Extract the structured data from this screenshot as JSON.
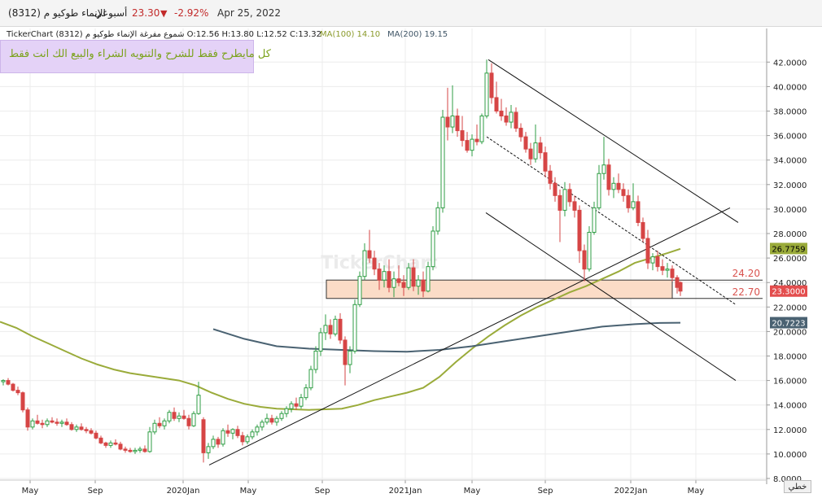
{
  "header": {
    "date": "Apr 25, 2022",
    "change": "-2.92%",
    "price": "23.30",
    "period": "أسبوعي",
    "name": "الإنماء طوكيو م (8312)"
  },
  "info": {
    "line": "TickerChart شموع مفرغة  الإنماء طوكيو م (8312) O:12.56 H:13.80 L:12.52 C:13.32",
    "ma100": "MA(100) 14.10",
    "ma200": "MA(200) 19.15"
  },
  "note": "كل مايطرح فقط للشرح  والتنويه الشراء والبيع الك انت فقط",
  "watermark": "TickerChart",
  "footer_button": "خطي",
  "colors": {
    "up": "#2f9e44",
    "down": "#d64545",
    "ma100": "#9aab3a",
    "ma200": "#4a6272",
    "zone_fill": "#fbdcc7",
    "last_price_tag": "#e34d4d"
  },
  "chart_data": {
    "type": "candlestick",
    "ylim": [
      8,
      43
    ],
    "y_ticks": [
      "8.0000",
      "10.0000",
      "12.0000",
      "14.0000",
      "16.0000",
      "18.0000",
      "20.0000",
      "22.0000",
      "24.0000",
      "26.0000",
      "28.0000",
      "30.0000",
      "32.0000",
      "34.0000",
      "36.0000",
      "38.0000",
      "40.0000",
      "42.0000"
    ],
    "x_ticks": [
      "May",
      "Sep",
      "2020Jan",
      "May",
      "Sep",
      "2021Jan",
      "May",
      "Sep",
      "2022Jan",
      "May"
    ],
    "last_price": "23.3000",
    "ma100_value": "26.7759",
    "ma200_value": "20.7223",
    "support_zone": {
      "high": 24.2,
      "low": 22.7,
      "high_label": "24.20",
      "low_label": "22.70"
    },
    "series": [
      {
        "name": "MA(100)",
        "points": [
          [
            0,
            20.8
          ],
          [
            20,
            20.3
          ],
          [
            40,
            19.6
          ],
          [
            60,
            19.0
          ],
          [
            80,
            18.4
          ],
          [
            100,
            17.8
          ],
          [
            120,
            17.3
          ],
          [
            140,
            16.9
          ],
          [
            160,
            16.6
          ],
          [
            180,
            16.4
          ],
          [
            200,
            16.2
          ],
          [
            220,
            16.0
          ],
          [
            240,
            15.6
          ],
          [
            260,
            15.0
          ],
          [
            280,
            14.5
          ],
          [
            300,
            14.1
          ],
          [
            320,
            13.85
          ],
          [
            340,
            13.7
          ],
          [
            360,
            13.65
          ],
          [
            380,
            13.6
          ],
          [
            400,
            13.65
          ],
          [
            420,
            13.7
          ],
          [
            440,
            14.0
          ],
          [
            460,
            14.4
          ],
          [
            480,
            14.7
          ],
          [
            500,
            15.0
          ],
          [
            520,
            15.4
          ],
          [
            540,
            16.3
          ],
          [
            560,
            17.5
          ],
          [
            580,
            18.6
          ],
          [
            600,
            19.6
          ],
          [
            620,
            20.5
          ],
          [
            640,
            21.3
          ],
          [
            660,
            22.0
          ],
          [
            680,
            22.6
          ],
          [
            700,
            23.2
          ],
          [
            720,
            23.7
          ],
          [
            740,
            24.3
          ],
          [
            760,
            24.9
          ],
          [
            780,
            25.6
          ],
          [
            800,
            26.0
          ],
          [
            820,
            26.4
          ],
          [
            836,
            26.75
          ]
        ]
      },
      {
        "name": "MA(200)",
        "points": [
          [
            262,
            20.2
          ],
          [
            300,
            19.4
          ],
          [
            340,
            18.8
          ],
          [
            380,
            18.6
          ],
          [
            420,
            18.5
          ],
          [
            460,
            18.4
          ],
          [
            500,
            18.35
          ],
          [
            540,
            18.5
          ],
          [
            580,
            18.8
          ],
          [
            620,
            19.2
          ],
          [
            660,
            19.6
          ],
          [
            700,
            20.0
          ],
          [
            740,
            20.4
          ],
          [
            780,
            20.6
          ],
          [
            810,
            20.7
          ],
          [
            836,
            20.72
          ]
        ]
      }
    ],
    "candles": [
      [
        4,
        15.9,
        16.1,
        15.6,
        16.0
      ],
      [
        10,
        16.0,
        16.2,
        15.6,
        15.7
      ],
      [
        16,
        15.7,
        15.8,
        15.1,
        15.2
      ],
      [
        22,
        15.2,
        15.5,
        14.8,
        15.0
      ],
      [
        28,
        15.0,
        15.1,
        13.4,
        13.6
      ],
      [
        34,
        13.6,
        13.8,
        11.9,
        12.2
      ],
      [
        40,
        12.2,
        12.9,
        12.0,
        12.7
      ],
      [
        46,
        12.7,
        13.2,
        12.4,
        12.5
      ],
      [
        52,
        12.5,
        12.8,
        12.1,
        12.4
      ],
      [
        58,
        12.4,
        12.9,
        12.2,
        12.7
      ],
      [
        64,
        12.7,
        13.0,
        12.5,
        12.6
      ],
      [
        70,
        12.6,
        12.9,
        12.3,
        12.5
      ],
      [
        76,
        12.5,
        12.8,
        12.2,
        12.6
      ],
      [
        82,
        12.6,
        12.9,
        12.3,
        12.4
      ],
      [
        88,
        12.4,
        12.6,
        11.9,
        12.0
      ],
      [
        94,
        12.0,
        12.4,
        11.8,
        12.2
      ],
      [
        100,
        12.2,
        12.5,
        11.9,
        12.0
      ],
      [
        106,
        12.0,
        12.2,
        11.7,
        11.9
      ],
      [
        112,
        11.9,
        12.1,
        11.6,
        11.7
      ],
      [
        118,
        11.7,
        11.9,
        11.2,
        11.3
      ],
      [
        124,
        11.3,
        11.5,
        10.8,
        10.9
      ],
      [
        130,
        10.9,
        11.0,
        10.5,
        10.7
      ],
      [
        136,
        10.7,
        11.1,
        10.5,
        10.9
      ],
      [
        142,
        10.9,
        11.2,
        10.7,
        10.8
      ],
      [
        148,
        10.8,
        11.0,
        10.3,
        10.4
      ],
      [
        154,
        10.4,
        10.6,
        10.1,
        10.3
      ],
      [
        160,
        10.3,
        10.5,
        10.1,
        10.2
      ],
      [
        166,
        10.2,
        10.5,
        10.0,
        10.3
      ],
      [
        172,
        10.3,
        10.6,
        10.1,
        10.4
      ],
      [
        178,
        10.4,
        10.7,
        10.1,
        10.2
      ],
      [
        184,
        10.2,
        12.2,
        10.1,
        11.8
      ],
      [
        190,
        11.8,
        12.8,
        11.6,
        12.5
      ],
      [
        196,
        12.5,
        13.0,
        12.1,
        12.3
      ],
      [
        202,
        12.3,
        12.9,
        12.0,
        12.7
      ],
      [
        208,
        12.7,
        13.6,
        12.5,
        13.4
      ],
      [
        214,
        13.4,
        13.8,
        12.7,
        12.9
      ],
      [
        220,
        12.9,
        13.4,
        12.6,
        13.1
      ],
      [
        226,
        13.1,
        13.6,
        12.8,
        12.9
      ],
      [
        232,
        12.9,
        13.2,
        12.0,
        12.3
      ],
      [
        238,
        12.3,
        13.5,
        12.2,
        13.3
      ],
      [
        244,
        13.3,
        15.9,
        13.2,
        14.8
      ],
      [
        250,
        12.8,
        13.0,
        9.3,
        10.1
      ],
      [
        256,
        10.1,
        10.9,
        9.6,
        10.6
      ],
      [
        262,
        10.6,
        11.5,
        10.4,
        11.2
      ],
      [
        268,
        11.2,
        11.4,
        10.5,
        10.8
      ],
      [
        274,
        10.8,
        12.1,
        10.6,
        11.9
      ],
      [
        280,
        11.9,
        12.4,
        11.4,
        11.7
      ],
      [
        286,
        11.7,
        12.1,
        11.2,
        12.0
      ],
      [
        292,
        12.0,
        12.3,
        11.3,
        11.5
      ],
      [
        298,
        11.5,
        11.8,
        10.7,
        11.0
      ],
      [
        304,
        11.0,
        11.6,
        10.8,
        11.4
      ],
      [
        310,
        11.4,
        12.0,
        11.2,
        11.8
      ],
      [
        316,
        11.8,
        12.4,
        11.5,
        12.2
      ],
      [
        322,
        12.2,
        12.8,
        11.9,
        12.6
      ],
      [
        328,
        12.6,
        13.3,
        12.4,
        12.9
      ],
      [
        334,
        12.9,
        13.2,
        12.4,
        12.6
      ],
      [
        340,
        12.6,
        13.1,
        12.3,
        12.9
      ],
      [
        346,
        12.9,
        13.5,
        12.7,
        13.3
      ],
      [
        352,
        13.3,
        13.9,
        13.0,
        13.7
      ],
      [
        358,
        13.7,
        14.3,
        13.4,
        14.1
      ],
      [
        364,
        14.1,
        14.6,
        13.6,
        13.9
      ],
      [
        370,
        13.9,
        14.9,
        13.7,
        14.6
      ],
      [
        376,
        14.6,
        15.7,
        14.4,
        15.4
      ],
      [
        382,
        15.4,
        17.2,
        15.2,
        16.9
      ],
      [
        388,
        16.9,
        18.8,
        16.6,
        18.4
      ],
      [
        394,
        18.4,
        20.3,
        18.0,
        19.9
      ],
      [
        400,
        19.9,
        21.4,
        19.3,
        20.5
      ],
      [
        406,
        20.5,
        21.0,
        19.4,
        19.8
      ],
      [
        412,
        19.8,
        21.3,
        19.6,
        21.0
      ],
      [
        418,
        21.0,
        21.5,
        19.0,
        19.3
      ],
      [
        424,
        19.3,
        19.6,
        15.6,
        17.3
      ],
      [
        430,
        17.3,
        18.8,
        16.6,
        18.4
      ],
      [
        436,
        18.4,
        22.6,
        18.2,
        22.2
      ],
      [
        442,
        22.2,
        24.9,
        22.0,
        24.5
      ],
      [
        448,
        24.5,
        27.2,
        24.2,
        26.6
      ],
      [
        454,
        26.6,
        28.3,
        25.6,
        26.0
      ],
      [
        460,
        26.0,
        26.6,
        24.6,
        25.1
      ],
      [
        466,
        25.1,
        25.6,
        23.4,
        24.2
      ],
      [
        472,
        24.2,
        25.4,
        23.6,
        24.9
      ],
      [
        478,
        24.9,
        25.9,
        23.2,
        23.6
      ],
      [
        484,
        23.6,
        24.9,
        22.8,
        24.3
      ],
      [
        490,
        24.3,
        25.4,
        23.7,
        24.0
      ],
      [
        496,
        24.0,
        24.6,
        22.9,
        23.6
      ],
      [
        502,
        23.6,
        25.6,
        23.4,
        25.2
      ],
      [
        508,
        25.2,
        25.9,
        23.3,
        23.7
      ],
      [
        514,
        23.7,
        24.6,
        23.0,
        24.2
      ],
      [
        520,
        24.2,
        24.9,
        22.8,
        23.3
      ],
      [
        526,
        23.3,
        25.7,
        23.2,
        25.3
      ],
      [
        532,
        25.3,
        28.6,
        25.0,
        28.2
      ],
      [
        538,
        28.2,
        30.6,
        27.9,
        30.1
      ],
      [
        544,
        30.1,
        38.1,
        29.7,
        37.5
      ],
      [
        550,
        37.5,
        39.9,
        35.6,
        36.7
      ],
      [
        556,
        36.7,
        40.1,
        36.2,
        37.6
      ],
      [
        562,
        37.6,
        38.2,
        35.9,
        36.4
      ],
      [
        568,
        36.4,
        37.6,
        35.1,
        35.6
      ],
      [
        574,
        35.6,
        36.3,
        34.6,
        34.8
      ],
      [
        580,
        34.8,
        36.1,
        34.3,
        35.7
      ],
      [
        586,
        35.7,
        36.9,
        35.2,
        35.5
      ],
      [
        592,
        35.5,
        37.8,
        35.3,
        37.6
      ],
      [
        598,
        37.6,
        42.2,
        37.4,
        41.1
      ],
      [
        604,
        41.1,
        41.9,
        38.6,
        39.1
      ],
      [
        610,
        39.1,
        40.4,
        37.8,
        38.0
      ],
      [
        616,
        38.0,
        39.0,
        37.2,
        37.6
      ],
      [
        622,
        37.6,
        38.3,
        36.8,
        37.1
      ],
      [
        628,
        37.1,
        38.5,
        36.6,
        37.9
      ],
      [
        634,
        37.9,
        38.3,
        36.3,
        36.6
      ],
      [
        640,
        36.6,
        37.0,
        35.5,
        35.9
      ],
      [
        646,
        35.9,
        36.3,
        34.6,
        34.9
      ],
      [
        652,
        34.9,
        35.4,
        33.6,
        34.1
      ],
      [
        658,
        34.1,
        36.9,
        33.8,
        35.4
      ],
      [
        664,
        35.4,
        35.9,
        34.1,
        34.6
      ],
      [
        670,
        34.6,
        35.1,
        32.6,
        33.1
      ],
      [
        676,
        33.1,
        33.6,
        31.6,
        32.1
      ],
      [
        682,
        32.1,
        32.6,
        30.6,
        31.1
      ],
      [
        688,
        31.1,
        31.6,
        27.3,
        29.9
      ],
      [
        694,
        29.9,
        32.2,
        29.4,
        31.6
      ],
      [
        700,
        31.6,
        32.1,
        30.2,
        30.6
      ],
      [
        706,
        30.6,
        31.1,
        29.3,
        29.9
      ],
      [
        712,
        29.9,
        30.3,
        25.6,
        26.6
      ],
      [
        718,
        26.6,
        27.1,
        24.1,
        25.1
      ],
      [
        724,
        25.1,
        28.6,
        24.9,
        28.1
      ],
      [
        730,
        28.1,
        30.6,
        27.9,
        30.1
      ],
      [
        736,
        30.1,
        33.6,
        29.9,
        32.9
      ],
      [
        742,
        32.9,
        35.9,
        32.4,
        33.6
      ],
      [
        748,
        33.6,
        34.1,
        31.1,
        31.6
      ],
      [
        754,
        31.6,
        32.6,
        30.9,
        32.1
      ],
      [
        760,
        32.1,
        32.9,
        31.3,
        31.6
      ],
      [
        766,
        31.6,
        32.1,
        30.6,
        31.1
      ],
      [
        772,
        31.1,
        31.6,
        29.7,
        30.1
      ],
      [
        778,
        30.1,
        32.1,
        29.9,
        30.6
      ],
      [
        784,
        30.6,
        31.1,
        28.6,
        28.9
      ],
      [
        790,
        28.9,
        29.3,
        27.3,
        27.6
      ],
      [
        796,
        27.6,
        28.3,
        25.1,
        25.6
      ],
      [
        802,
        25.6,
        26.4,
        25.0,
        26.1
      ],
      [
        808,
        26.1,
        26.6,
        24.9,
        25.3
      ],
      [
        814,
        25.3,
        25.9,
        24.6,
        25.0
      ],
      [
        820,
        25.0,
        25.6,
        24.4,
        25.1
      ],
      [
        826,
        25.1,
        25.4,
        24.1,
        24.4
      ],
      [
        832,
        24.4,
        24.6,
        23.1,
        23.6
      ],
      [
        836,
        24.0,
        24.1,
        22.9,
        23.3
      ]
    ],
    "trendlines": [
      {
        "name": "rising-support-line",
        "style": "solid",
        "points": [
          [
            257,
            9.1
          ],
          [
            897,
            30.1
          ]
        ]
      },
      {
        "name": "channel-upper-line",
        "style": "solid",
        "points": [
          [
            600,
            42.2
          ],
          [
            907,
            28.9
          ]
        ]
      },
      {
        "name": "channel-lower-line",
        "style": "solid",
        "points": [
          [
            597,
            29.7
          ],
          [
            904,
            16.0
          ]
        ]
      },
      {
        "name": "channel-mid-line",
        "style": "dashed",
        "points": [
          [
            598,
            35.9
          ],
          [
            904,
            22.2
          ]
        ]
      }
    ]
  }
}
